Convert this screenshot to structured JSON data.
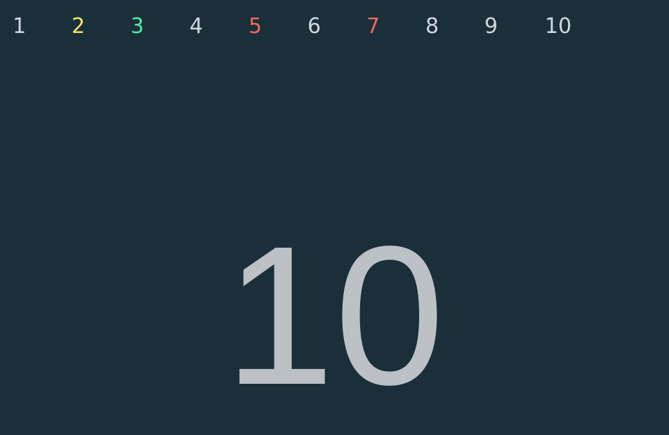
{
  "nav": {
    "items": [
      {
        "label": "1",
        "color": "#cfd7dc"
      },
      {
        "label": "2",
        "color": "#f5e06a"
      },
      {
        "label": "3",
        "color": "#4de8a4"
      },
      {
        "label": "4",
        "color": "#cfd7dc"
      },
      {
        "label": "5",
        "color": "#ee6a52"
      },
      {
        "label": "6",
        "color": "#cfd7dc"
      },
      {
        "label": "7",
        "color": "#ee6a52"
      },
      {
        "label": "8",
        "color": "#cfd7dc"
      },
      {
        "label": "9",
        "color": "#cfd7dc"
      },
      {
        "label": "10",
        "color": "#cfd7dc"
      }
    ]
  },
  "display": {
    "value": "10",
    "color": "#bbc1c5"
  },
  "theme": {
    "background": "#1a2f3a"
  }
}
